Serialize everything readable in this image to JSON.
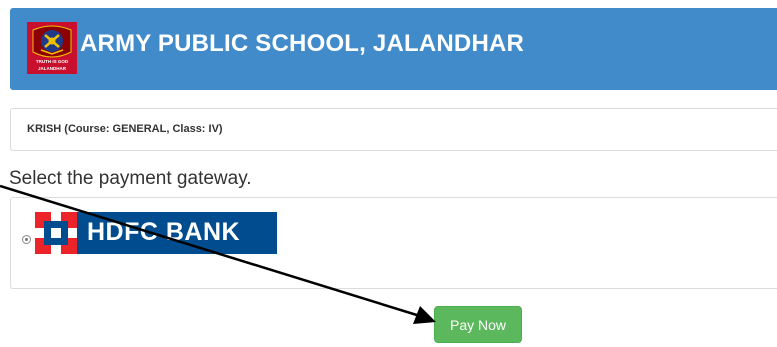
{
  "header": {
    "school_name": "ARMY PUBLIC SCHOOL, JALANDHAR",
    "background_color": "#428bca",
    "logo": {
      "icon": "army-school-crest-icon",
      "motto": "TRUTH IS GOD",
      "city": "JALANDHAR"
    }
  },
  "student": {
    "info": "KRISH (Course: GENERAL, Class: IV)"
  },
  "payment": {
    "prompt": "Select the payment gateway.",
    "gateways": [
      {
        "name": "HDFC BANK",
        "icon": "hdfc-bank-logo-icon",
        "selected": true,
        "brand_color": "#004c8f",
        "accent_color": "#ed232a"
      }
    ],
    "submit_label": "Pay Now",
    "submit_color": "#5cb85c"
  },
  "annotation": {
    "type": "arrow",
    "color": "#000000",
    "target": "pay-now-button"
  }
}
